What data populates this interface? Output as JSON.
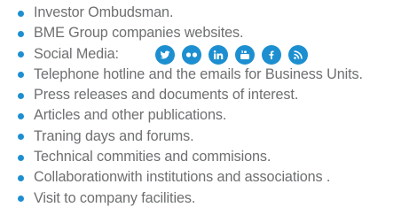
{
  "items": [
    {
      "label": "Investor Ombudsman."
    },
    {
      "label": "BME Group companies websites."
    },
    {
      "label": "Social Media:"
    },
    {
      "label": "Telephone hotline and the emails for Business Units."
    },
    {
      "label": "Press releases and documents of interest."
    },
    {
      "label": "Articles and other publications."
    },
    {
      "label": "Traning days and forums."
    },
    {
      "label": "Technical commities and commisions."
    },
    {
      "label": "Collaborationwith institutions and associations ."
    },
    {
      "label": "Visit to company facilities."
    }
  ],
  "social_icons": [
    {
      "icon": "twitter-icon"
    },
    {
      "icon": "flickr-icon"
    },
    {
      "icon": "linkedin-icon"
    },
    {
      "icon": "youtube-icon"
    },
    {
      "icon": "facebook-icon"
    },
    {
      "icon": "rss-icon"
    }
  ],
  "colors": {
    "text": "#6d6f70",
    "accent": "#1d8fd0"
  }
}
